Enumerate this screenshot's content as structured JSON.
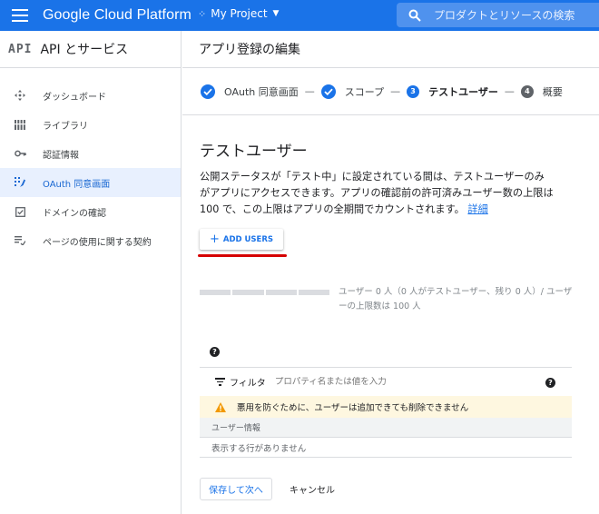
{
  "topbar": {
    "brand": "Google Cloud Platform",
    "project": "My Project",
    "search_placeholder": "プロダクトとリソースの検索"
  },
  "sidebar": {
    "logo": "API",
    "title": "API とサービス",
    "items": [
      {
        "label": "ダッシュボード",
        "icon": "dashboard-icon"
      },
      {
        "label": "ライブラリ",
        "icon": "library-icon"
      },
      {
        "label": "認証情報",
        "icon": "key-icon"
      },
      {
        "label": "OAuth 同意画面",
        "icon": "consent-icon",
        "active": true
      },
      {
        "label": "ドメインの確認",
        "icon": "domain-check-icon"
      },
      {
        "label": "ページの使用に関する契約",
        "icon": "agreement-icon"
      }
    ]
  },
  "page": {
    "title": "アプリ登録の編集"
  },
  "stepper": {
    "steps": [
      {
        "label": "OAuth 同意画面",
        "state": "done"
      },
      {
        "label": "スコープ",
        "state": "done"
      },
      {
        "number": "3",
        "label": "テストユーザー",
        "state": "current"
      },
      {
        "number": "4",
        "label": "概要",
        "state": "todo"
      }
    ],
    "separator": "—"
  },
  "test_users": {
    "heading": "テストユーザー",
    "description": "公開ステータスが「テスト中」に設定されている間は、テストユーザーのみがアプリにアクセスできます。アプリの確認前の許可済みユーザー数の上限は 100 で、この上限はアプリの全期間でカウントされます。",
    "details_link": "詳細",
    "add_users_label": "ADD USERS",
    "quota_text": "ユーザー 0 人（0 人がテストユーザー、残り 0 人）/ ユーザーの上限数は 100 人",
    "quota_used": 0
  },
  "table": {
    "filter_label": "フィルタ",
    "filter_placeholder": "プロパティ名または値を入力",
    "warning": "悪用を防ぐために、ユーザーは追加できても削除できません",
    "column_header": "ユーザー情報",
    "empty_text": "表示する行がありません",
    "help_glyph": "?"
  },
  "actions": {
    "save_next": "保存して次へ",
    "cancel": "キャンセル"
  },
  "colors": {
    "primary": "#1a73e8",
    "warning_bg": "#fef7e0",
    "warning_icon": "#f29900",
    "highlight_underline": "#d50000"
  }
}
